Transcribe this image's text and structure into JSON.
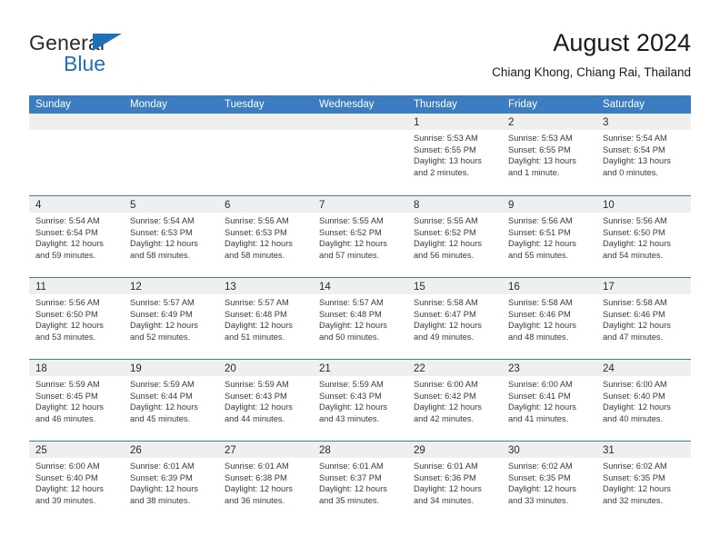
{
  "brand": {
    "name_part1": "General",
    "name_part2": "Blue",
    "triangle_icon": "triangle-icon",
    "accent_color": "#1c71b9"
  },
  "header": {
    "title": "August 2024",
    "subtitle": "Chiang Khong, Chiang Rai, Thailand"
  },
  "calendar": {
    "header_color": "#3b7dc0",
    "day_band_color": "#efefef",
    "weekdays": [
      "Sunday",
      "Monday",
      "Tuesday",
      "Wednesday",
      "Thursday",
      "Friday",
      "Saturday"
    ],
    "weeks": [
      [
        {
          "day": "",
          "sunrise": "",
          "sunset": "",
          "daylight_line1": "",
          "daylight_line2": ""
        },
        {
          "day": "",
          "sunrise": "",
          "sunset": "",
          "daylight_line1": "",
          "daylight_line2": ""
        },
        {
          "day": "",
          "sunrise": "",
          "sunset": "",
          "daylight_line1": "",
          "daylight_line2": ""
        },
        {
          "day": "",
          "sunrise": "",
          "sunset": "",
          "daylight_line1": "",
          "daylight_line2": ""
        },
        {
          "day": "1",
          "sunrise": "Sunrise: 5:53 AM",
          "sunset": "Sunset: 6:55 PM",
          "daylight_line1": "Daylight: 13 hours",
          "daylight_line2": "and 2 minutes."
        },
        {
          "day": "2",
          "sunrise": "Sunrise: 5:53 AM",
          "sunset": "Sunset: 6:55 PM",
          "daylight_line1": "Daylight: 13 hours",
          "daylight_line2": "and 1 minute."
        },
        {
          "day": "3",
          "sunrise": "Sunrise: 5:54 AM",
          "sunset": "Sunset: 6:54 PM",
          "daylight_line1": "Daylight: 13 hours",
          "daylight_line2": "and 0 minutes."
        }
      ],
      [
        {
          "day": "4",
          "sunrise": "Sunrise: 5:54 AM",
          "sunset": "Sunset: 6:54 PM",
          "daylight_line1": "Daylight: 12 hours",
          "daylight_line2": "and 59 minutes."
        },
        {
          "day": "5",
          "sunrise": "Sunrise: 5:54 AM",
          "sunset": "Sunset: 6:53 PM",
          "daylight_line1": "Daylight: 12 hours",
          "daylight_line2": "and 58 minutes."
        },
        {
          "day": "6",
          "sunrise": "Sunrise: 5:55 AM",
          "sunset": "Sunset: 6:53 PM",
          "daylight_line1": "Daylight: 12 hours",
          "daylight_line2": "and 58 minutes."
        },
        {
          "day": "7",
          "sunrise": "Sunrise: 5:55 AM",
          "sunset": "Sunset: 6:52 PM",
          "daylight_line1": "Daylight: 12 hours",
          "daylight_line2": "and 57 minutes."
        },
        {
          "day": "8",
          "sunrise": "Sunrise: 5:55 AM",
          "sunset": "Sunset: 6:52 PM",
          "daylight_line1": "Daylight: 12 hours",
          "daylight_line2": "and 56 minutes."
        },
        {
          "day": "9",
          "sunrise": "Sunrise: 5:56 AM",
          "sunset": "Sunset: 6:51 PM",
          "daylight_line1": "Daylight: 12 hours",
          "daylight_line2": "and 55 minutes."
        },
        {
          "day": "10",
          "sunrise": "Sunrise: 5:56 AM",
          "sunset": "Sunset: 6:50 PM",
          "daylight_line1": "Daylight: 12 hours",
          "daylight_line2": "and 54 minutes."
        }
      ],
      [
        {
          "day": "11",
          "sunrise": "Sunrise: 5:56 AM",
          "sunset": "Sunset: 6:50 PM",
          "daylight_line1": "Daylight: 12 hours",
          "daylight_line2": "and 53 minutes."
        },
        {
          "day": "12",
          "sunrise": "Sunrise: 5:57 AM",
          "sunset": "Sunset: 6:49 PM",
          "daylight_line1": "Daylight: 12 hours",
          "daylight_line2": "and 52 minutes."
        },
        {
          "day": "13",
          "sunrise": "Sunrise: 5:57 AM",
          "sunset": "Sunset: 6:48 PM",
          "daylight_line1": "Daylight: 12 hours",
          "daylight_line2": "and 51 minutes."
        },
        {
          "day": "14",
          "sunrise": "Sunrise: 5:57 AM",
          "sunset": "Sunset: 6:48 PM",
          "daylight_line1": "Daylight: 12 hours",
          "daylight_line2": "and 50 minutes."
        },
        {
          "day": "15",
          "sunrise": "Sunrise: 5:58 AM",
          "sunset": "Sunset: 6:47 PM",
          "daylight_line1": "Daylight: 12 hours",
          "daylight_line2": "and 49 minutes."
        },
        {
          "day": "16",
          "sunrise": "Sunrise: 5:58 AM",
          "sunset": "Sunset: 6:46 PM",
          "daylight_line1": "Daylight: 12 hours",
          "daylight_line2": "and 48 minutes."
        },
        {
          "day": "17",
          "sunrise": "Sunrise: 5:58 AM",
          "sunset": "Sunset: 6:46 PM",
          "daylight_line1": "Daylight: 12 hours",
          "daylight_line2": "and 47 minutes."
        }
      ],
      [
        {
          "day": "18",
          "sunrise": "Sunrise: 5:59 AM",
          "sunset": "Sunset: 6:45 PM",
          "daylight_line1": "Daylight: 12 hours",
          "daylight_line2": "and 46 minutes."
        },
        {
          "day": "19",
          "sunrise": "Sunrise: 5:59 AM",
          "sunset": "Sunset: 6:44 PM",
          "daylight_line1": "Daylight: 12 hours",
          "daylight_line2": "and 45 minutes."
        },
        {
          "day": "20",
          "sunrise": "Sunrise: 5:59 AM",
          "sunset": "Sunset: 6:43 PM",
          "daylight_line1": "Daylight: 12 hours",
          "daylight_line2": "and 44 minutes."
        },
        {
          "day": "21",
          "sunrise": "Sunrise: 5:59 AM",
          "sunset": "Sunset: 6:43 PM",
          "daylight_line1": "Daylight: 12 hours",
          "daylight_line2": "and 43 minutes."
        },
        {
          "day": "22",
          "sunrise": "Sunrise: 6:00 AM",
          "sunset": "Sunset: 6:42 PM",
          "daylight_line1": "Daylight: 12 hours",
          "daylight_line2": "and 42 minutes."
        },
        {
          "day": "23",
          "sunrise": "Sunrise: 6:00 AM",
          "sunset": "Sunset: 6:41 PM",
          "daylight_line1": "Daylight: 12 hours",
          "daylight_line2": "and 41 minutes."
        },
        {
          "day": "24",
          "sunrise": "Sunrise: 6:00 AM",
          "sunset": "Sunset: 6:40 PM",
          "daylight_line1": "Daylight: 12 hours",
          "daylight_line2": "and 40 minutes."
        }
      ],
      [
        {
          "day": "25",
          "sunrise": "Sunrise: 6:00 AM",
          "sunset": "Sunset: 6:40 PM",
          "daylight_line1": "Daylight: 12 hours",
          "daylight_line2": "and 39 minutes."
        },
        {
          "day": "26",
          "sunrise": "Sunrise: 6:01 AM",
          "sunset": "Sunset: 6:39 PM",
          "daylight_line1": "Daylight: 12 hours",
          "daylight_line2": "and 38 minutes."
        },
        {
          "day": "27",
          "sunrise": "Sunrise: 6:01 AM",
          "sunset": "Sunset: 6:38 PM",
          "daylight_line1": "Daylight: 12 hours",
          "daylight_line2": "and 36 minutes."
        },
        {
          "day": "28",
          "sunrise": "Sunrise: 6:01 AM",
          "sunset": "Sunset: 6:37 PM",
          "daylight_line1": "Daylight: 12 hours",
          "daylight_line2": "and 35 minutes."
        },
        {
          "day": "29",
          "sunrise": "Sunrise: 6:01 AM",
          "sunset": "Sunset: 6:36 PM",
          "daylight_line1": "Daylight: 12 hours",
          "daylight_line2": "and 34 minutes."
        },
        {
          "day": "30",
          "sunrise": "Sunrise: 6:02 AM",
          "sunset": "Sunset: 6:35 PM",
          "daylight_line1": "Daylight: 12 hours",
          "daylight_line2": "and 33 minutes."
        },
        {
          "day": "31",
          "sunrise": "Sunrise: 6:02 AM",
          "sunset": "Sunset: 6:35 PM",
          "daylight_line1": "Daylight: 12 hours",
          "daylight_line2": "and 32 minutes."
        }
      ]
    ]
  }
}
